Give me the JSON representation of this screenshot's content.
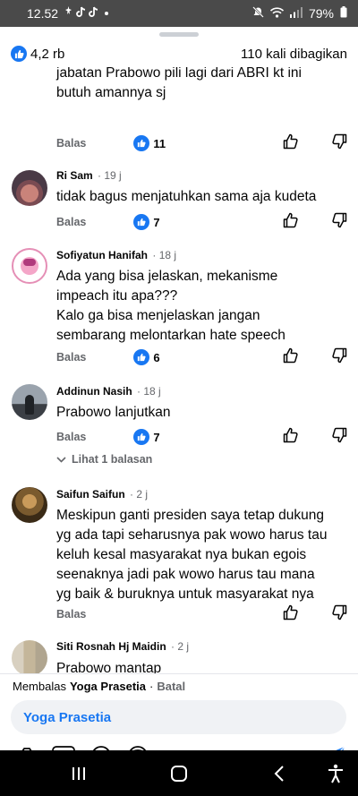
{
  "status": {
    "time": "12.52",
    "battery": "79%"
  },
  "summary": {
    "likes": "4,2 rb",
    "shares": "110 kali dibagikan"
  },
  "comments": [
    {
      "name": "",
      "time": "",
      "text": [
        "jabatan Prabowo pili lagi dari ABRI  kt ini",
        "butuh amannya sj"
      ],
      "reply": "Balas",
      "likes": "11"
    },
    {
      "name": "Ri Sam",
      "time": "· 19 j",
      "text": [
        "tidak bagus menjatuhkan sama aja kudeta"
      ],
      "reply": "Balas",
      "likes": "7"
    },
    {
      "name": "Sofiyatun Hanifah",
      "time": "· 18 j",
      "text": [
        "Ada yang bisa jelaskan, mekanisme",
        "impeach itu apa???",
        "Kalo ga bisa menjelaskan jangan",
        "sembarang melontarkan hate speech"
      ],
      "reply": "Balas",
      "likes": "6"
    },
    {
      "name": "Addinun Nasih",
      "time": "· 18 j",
      "text": [
        "Prabowo lanjutkan"
      ],
      "reply": "Balas",
      "likes": "7",
      "see_replies": "Lihat 1 balasan"
    },
    {
      "name": "Saifun Saifun",
      "time": "· 2 j",
      "text": [
        "Meskipun ganti presiden saya tetap dukung",
        "yg ada tapi seharusnya pak wowo harus tau",
        "keluh kesal masyarakat nya bukan egois",
        "seenaknya jadi pak wowo harus tau mana",
        "yg baik & buruknya untuk masyarakat nya"
      ],
      "reply": "Balas"
    },
    {
      "name": "Siti Rosnah Hj Maidin",
      "time": "· 2 j",
      "text": [
        "Prabowo mantap"
      ]
    }
  ],
  "reply_bar": {
    "prefix": "Membalas",
    "target": "Yoga Prasetia",
    "sep": "·",
    "cancel": "Batal"
  },
  "input": {
    "mention": "Yoga Prasetia"
  },
  "colors": {
    "accent": "#1877f2",
    "secondary_text": "#65676b",
    "status_bar": "#4a4a4a"
  },
  "icons": [
    "camera-icon",
    "gif-icon",
    "emoji-icon",
    "avatar-sticker-icon",
    "send-icon",
    "recent-apps-icon",
    "home-icon",
    "back-icon",
    "accessibility-icon"
  ]
}
